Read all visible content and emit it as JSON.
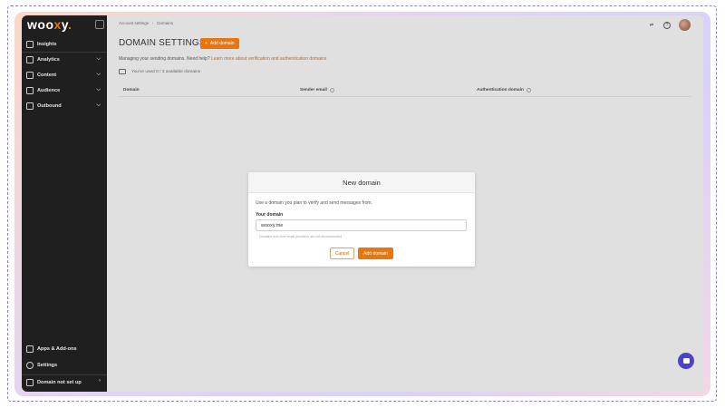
{
  "app": {
    "logo": "woo",
    "logo_x": "x",
    "logo_end": "y",
    "logo_dot": "."
  },
  "sidebar": {
    "items": [
      {
        "label": "Insights",
        "icon": "chart-square-icon"
      },
      {
        "label": "Analytics",
        "icon": "analytics-icon"
      },
      {
        "label": "Content",
        "icon": "content-icon"
      },
      {
        "label": "Audience",
        "icon": "audience-icon"
      },
      {
        "label": "Outbound",
        "icon": "rocket-icon"
      }
    ],
    "bottom_items": [
      {
        "label": "Apps & Add-ons",
        "icon": "apps-grid-icon"
      },
      {
        "label": "Settings",
        "icon": "gear-icon"
      },
      {
        "label": "Domain not set up",
        "icon": "domain-icon"
      }
    ]
  },
  "header": {
    "breadcrumb": [
      "Account settings",
      "Domains"
    ],
    "title": "DOMAIN SETTINGS",
    "add_button": "Add domain",
    "add_button_icon": "+"
  },
  "intro": {
    "text": "Managing your sending domains. Need help?",
    "link": "Learn more about verification and authentication domains"
  },
  "usage": {
    "text": "You've used 0 / 3 available domains"
  },
  "table": {
    "columns": [
      "Domain",
      "Sender email",
      "Authentication domain"
    ]
  },
  "modal": {
    "title": "New domain",
    "description": "Use a domain you plan to verify and send messages from.",
    "field_label": "Your domain",
    "field_value": "wooxy.me",
    "hint": "Domains from free email providers are not recommended",
    "cancel": "Cancel",
    "submit": "Add domain"
  },
  "colors": {
    "accent": "#e8760f",
    "sidebar_bg": "#1f1f1f",
    "chat": "#4b44c8"
  }
}
